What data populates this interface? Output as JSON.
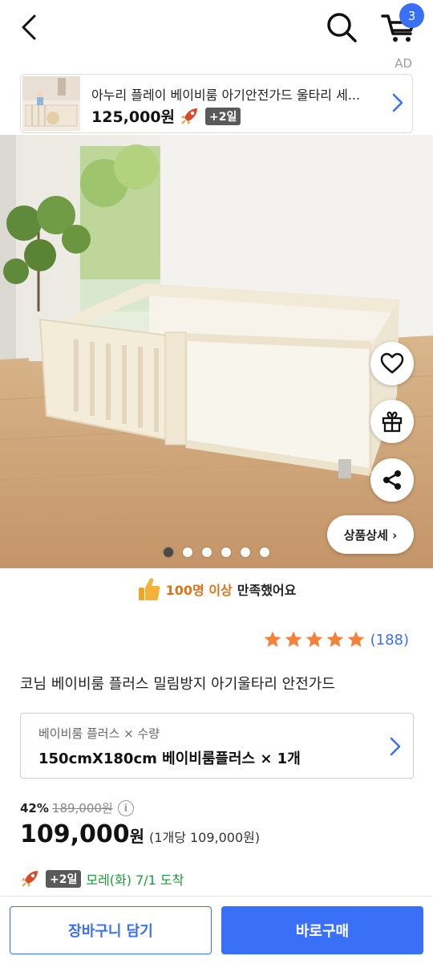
{
  "header": {
    "cart_count": "3",
    "ad_label": "AD"
  },
  "ad": {
    "title": "아누리 플레이 베이비룸 아기안전가드 울타리 세...",
    "price": "125,000원",
    "delivery_badge": "+2일"
  },
  "gallery": {
    "detail_button": "상품상세 ›",
    "total_images": 6,
    "active_index": 0
  },
  "satisfaction": {
    "highlight": "100명 이상",
    "rest": "만족했어요"
  },
  "rating": {
    "stars": 5,
    "count": "(188)"
  },
  "product": {
    "title": "코님 베이비룸 플러스 밀림방지 아기울타리 안전가드"
  },
  "option": {
    "label": "베이비룸 플러스 × 수량",
    "value": "150cmX180cm 베이비룸플러스 × 1개"
  },
  "pricing": {
    "discount": "42%",
    "original_price": "189,000원",
    "info_icon": "i",
    "price": "109,000",
    "currency": "원",
    "unit_price": "(1개당 109,000원)"
  },
  "arrival": {
    "badge": "+2일",
    "text": "모레(화) 7/1 도착"
  },
  "bottom": {
    "cart_button": "장바구니 담기",
    "buy_button": "바로구매"
  },
  "colors": {
    "accent": "#3a6ff7",
    "satisfaction": "#e0731a",
    "arrival": "#1f9a39",
    "star": "#f3833a"
  }
}
